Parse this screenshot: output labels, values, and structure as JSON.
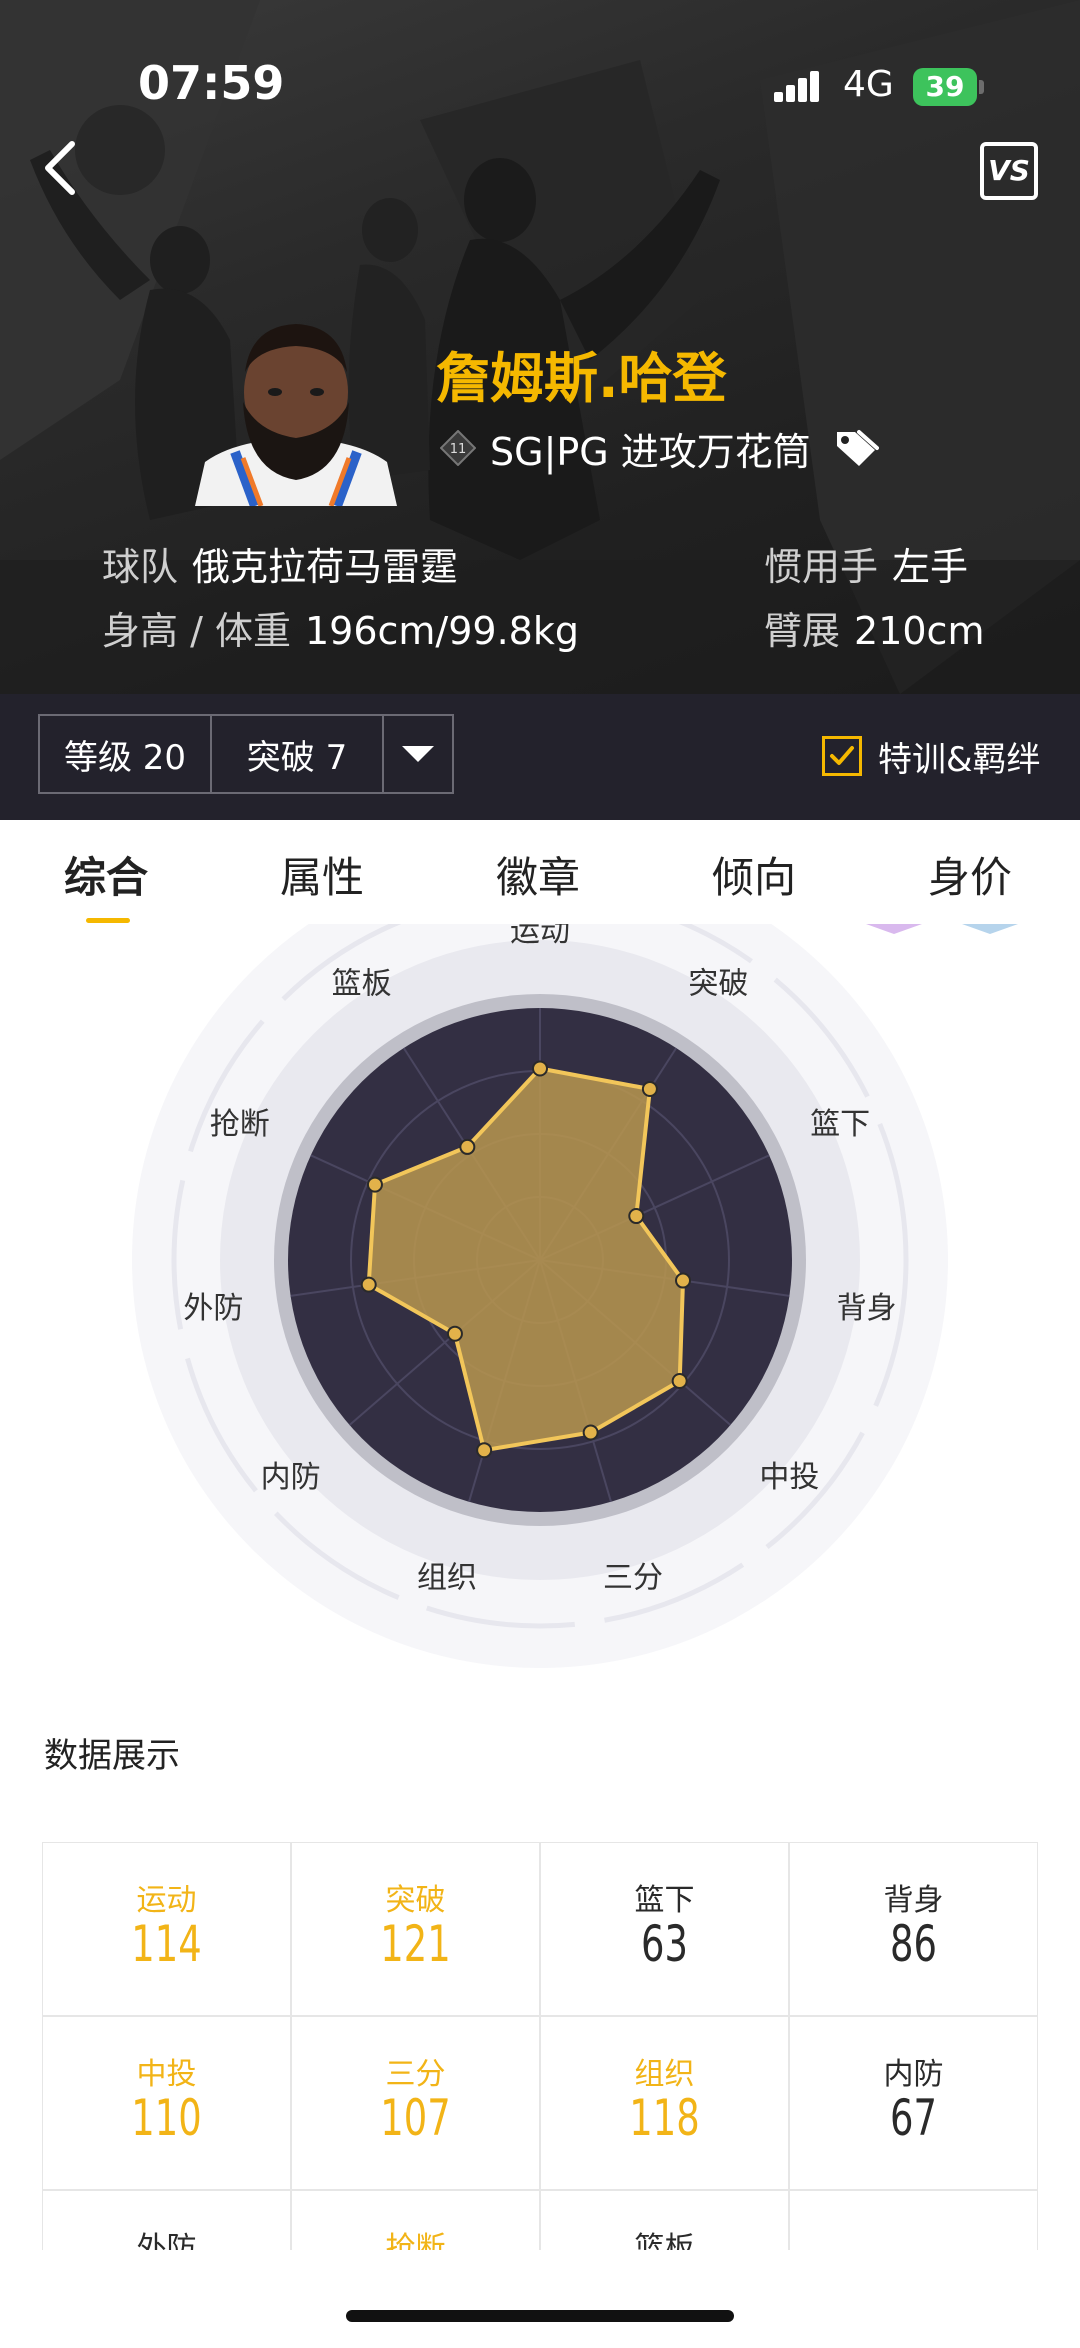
{
  "status_bar": {
    "time": "07:59",
    "network": "4G",
    "battery": "39"
  },
  "header": {
    "vs_label": "VS"
  },
  "player": {
    "name": "詹姆斯.哈登",
    "level_badge": "11",
    "position_archetype": "SG|PG 进攻万花筒",
    "team_label": "球队",
    "team": "俄克拉荷马雷霆",
    "height_weight_label": "身高 / 体重",
    "height_weight": "196cm/99.8kg",
    "hand_label": "惯用手",
    "hand": "左手",
    "wingspan_label": "臂展",
    "wingspan": "210cm"
  },
  "controls": {
    "level": "等级 20",
    "breakthrough": "突破 7",
    "training_label": "特训&羁绊",
    "training_checked": true
  },
  "tabs": [
    "综合",
    "属性",
    "徽章",
    "倾向",
    "身价"
  ],
  "active_tab": 0,
  "radar": {
    "axes": [
      "运动",
      "突破",
      "篮下",
      "背身",
      "中投",
      "三分",
      "组织",
      "内防",
      "外防",
      "抢断",
      "篮板"
    ],
    "colors": {
      "fill": "#b8964f",
      "stroke": "#f2c65a",
      "dark": "#332f43"
    }
  },
  "chart_data": {
    "type": "radar",
    "categories": [
      "运动",
      "突破",
      "篮下",
      "背身",
      "中投",
      "三分",
      "组织",
      "内防",
      "外防",
      "抢断",
      "篮板"
    ],
    "values": [
      114,
      121,
      63,
      86,
      110,
      107,
      118,
      67,
      null,
      null,
      null
    ],
    "ylim": [
      0,
      150
    ]
  },
  "stats_section": {
    "title": "数据展示",
    "cells": [
      {
        "label": "运动",
        "value": "114",
        "highlight": true
      },
      {
        "label": "突破",
        "value": "121",
        "highlight": true
      },
      {
        "label": "篮下",
        "value": "63",
        "highlight": false
      },
      {
        "label": "背身",
        "value": "86",
        "highlight": false
      },
      {
        "label": "中投",
        "value": "110",
        "highlight": true
      },
      {
        "label": "三分",
        "value": "107",
        "highlight": true
      },
      {
        "label": "组织",
        "value": "118",
        "highlight": true
      },
      {
        "label": "内防",
        "value": "67",
        "highlight": false
      },
      {
        "label": "外防",
        "value": "",
        "highlight": false
      },
      {
        "label": "抢断",
        "value": "",
        "highlight": true
      },
      {
        "label": "篮板",
        "value": "",
        "highlight": false
      }
    ]
  }
}
